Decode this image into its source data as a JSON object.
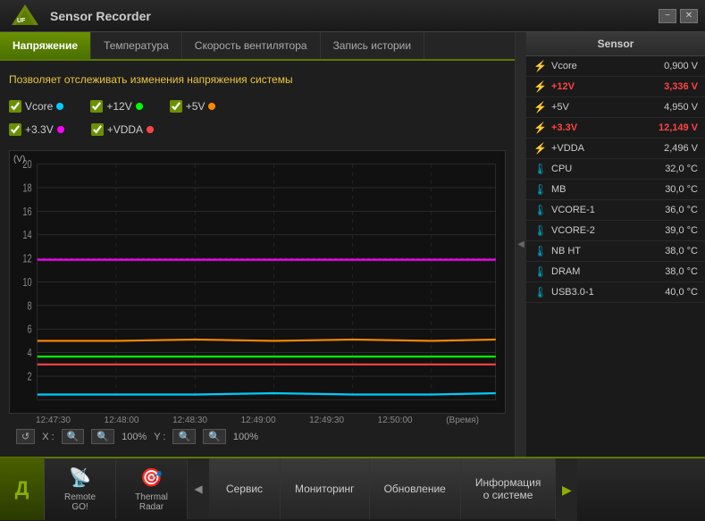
{
  "window": {
    "title": "Sensor Recorder",
    "minimize_label": "−",
    "close_label": "✕"
  },
  "tabs": [
    {
      "id": "voltage",
      "label": "Напряжение",
      "active": true
    },
    {
      "id": "temperature",
      "label": "Температура",
      "active": false
    },
    {
      "id": "fan_speed",
      "label": "Скорость вентилятора",
      "active": false
    },
    {
      "id": "history",
      "label": "Запись истории",
      "active": false
    }
  ],
  "description": "Позволяет отслеживать изменения напряжения системы",
  "checkboxes": [
    {
      "id": "vcore",
      "label": "Vcore",
      "color": "#00ccff",
      "checked": true
    },
    {
      "id": "plus12v",
      "label": "+12V",
      "color": "#00ff00",
      "checked": true
    },
    {
      "id": "plus5v",
      "label": "+5V",
      "color": "#ff8800",
      "checked": true
    },
    {
      "id": "plus33v",
      "label": "+3.3V",
      "color": "#ff00ff",
      "checked": true
    },
    {
      "id": "vdda",
      "label": "+VDDA",
      "color": "#ff4444",
      "checked": true
    }
  ],
  "chart": {
    "y_label": "(V)",
    "y_values": [
      "20",
      "18",
      "16",
      "14",
      "12",
      "10",
      "8",
      "6",
      "4",
      "2"
    ],
    "x_labels": [
      "12:47:30",
      "12:48:00",
      "12:48:30",
      "12:49:00",
      "12:49:30",
      "12:50:00"
    ],
    "time_label": "(Время)"
  },
  "controls": {
    "reset_label": "↺",
    "x_label": "X :",
    "zoom_in_label": "🔍",
    "zoom_out_label": "🔍",
    "x_percent": "100%",
    "y_label": "Y :",
    "y_zoom_in_label": "🔍",
    "y_zoom_out_label": "🔍",
    "y_percent": "100%"
  },
  "sensor_panel": {
    "header": "Sensor",
    "sensors": [
      {
        "icon": "⚡",
        "name": "Vcore",
        "value": "0,900 V",
        "highlight": false
      },
      {
        "icon": "⚡",
        "name": "+12V",
        "value": "3,336 V",
        "highlight": true
      },
      {
        "icon": "⚡",
        "name": "+5V",
        "value": "4,950 V",
        "highlight": false
      },
      {
        "icon": "⚡",
        "name": "+3.3V",
        "value": "12,149 V",
        "highlight": true
      },
      {
        "icon": "⚡",
        "name": "+VDDA",
        "value": "2,496 V",
        "highlight": false
      },
      {
        "icon": "🌡",
        "name": "CPU",
        "value": "32,0 °C",
        "highlight": false
      },
      {
        "icon": "🌡",
        "name": "MB",
        "value": "30,0 °C",
        "highlight": false
      },
      {
        "icon": "🌡",
        "name": "VCORE-1",
        "value": "36,0 °C",
        "highlight": false
      },
      {
        "icon": "🌡",
        "name": "VCORE-2",
        "value": "39,0 °C",
        "highlight": false
      },
      {
        "icon": "🌡",
        "name": "NB HT",
        "value": "38,0 °C",
        "highlight": false
      },
      {
        "icon": "🌡",
        "name": "DRAM",
        "value": "38,0 °C",
        "highlight": false
      },
      {
        "icon": "🌡",
        "name": "USB3.0-1",
        "value": "40,0 °C",
        "highlight": false
      }
    ]
  },
  "taskbar": {
    "logo": "Д",
    "items": [
      {
        "id": "remote",
        "label": "Remote\nGO!",
        "icon": "📡"
      },
      {
        "id": "thermal",
        "label": "Thermal\nRadar",
        "icon": "🎯"
      }
    ],
    "buttons": [
      {
        "id": "service",
        "label": "Сервис"
      },
      {
        "id": "monitoring",
        "label": "Мониторинг"
      },
      {
        "id": "updates",
        "label": "Обновление"
      },
      {
        "id": "info",
        "label": "Информация\nо системе"
      }
    ],
    "arrow": "▶"
  }
}
